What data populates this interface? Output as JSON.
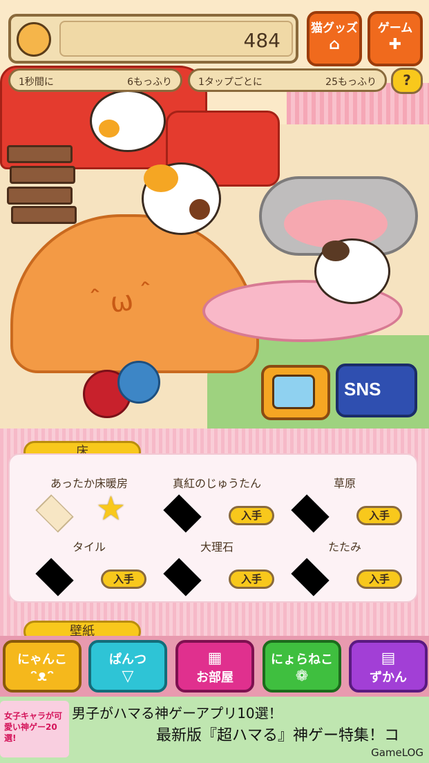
{
  "hud": {
    "money": "484",
    "rate_per_sec_label": "1秒間に",
    "rate_per_sec_value": "6もっふり",
    "rate_per_tap_label": "1タップごとに",
    "rate_per_tap_value": "25もっふり",
    "help": "?"
  },
  "top_buttons": {
    "goods": "猫グッズ",
    "game": "ゲーム"
  },
  "scene": {
    "sns": "SNS"
  },
  "shop": {
    "section_floor": "床",
    "section_wallpaper": "壁紙",
    "buy_label": "入手",
    "items": [
      {
        "name": "あったか床暖房",
        "state": "owned"
      },
      {
        "name": "真紅のじゅうたん",
        "state": "locked"
      },
      {
        "name": "草原",
        "state": "locked"
      },
      {
        "name": "タイル",
        "state": "locked"
      },
      {
        "name": "大理石",
        "state": "locked"
      },
      {
        "name": "たたみ",
        "state": "locked"
      }
    ]
  },
  "nav": {
    "nyanko": "にゃんこ",
    "pantsu": "ぱんつ",
    "oheya": "お部屋",
    "hiraneko": "にょらねこ",
    "zukan": "ずかん"
  },
  "ad": {
    "thumb_text": "女子キャラが可愛い神ゲー20選!",
    "line1": "男子がハマる神ゲーアプリ10選！",
    "line2": "最新版『超ハマる』神ゲー特集！コ",
    "brand": "GameLOG"
  },
  "colors": {
    "accent_yellow": "#f8c81c",
    "accent_orange": "#f06a1d",
    "nav_yellow": "#f5b81c",
    "nav_cyan": "#2ec4d6",
    "nav_magenta": "#e0308e",
    "nav_green": "#3fbf3f",
    "nav_purple": "#a23fd6"
  }
}
